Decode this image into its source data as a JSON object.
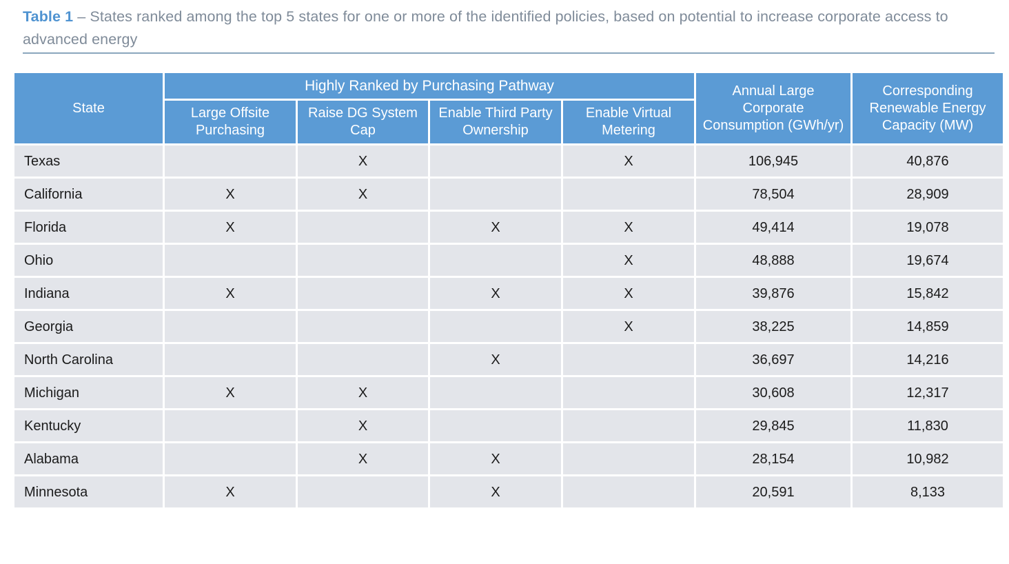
{
  "caption": {
    "label": "Table 1",
    "dash": " – ",
    "text": "States ranked among the top 5 states for one or more of the identified policies, based on potential to increase corporate access to advanced energy",
    "label_color": "#4f93d1",
    "text_color": "#7f8b99",
    "rule_color": "#8aa6bd"
  },
  "table": {
    "header_bg": "#5b9bd5",
    "header_fg": "#ffffff",
    "cell_bg": "#e3e5ea",
    "cell_fg": "#1b1b1b",
    "group_header": "Highly Ranked by Purchasing Pathway",
    "columns": [
      "State",
      "Large Offsite Purchasing",
      "Raise DG System Cap",
      "Enable Third Party Ownership",
      "Enable Virtual Metering",
      "Annual Large Corporate Consumption (GWh/yr)",
      "Corresponding Renewable Energy Capacity (MW)"
    ],
    "mark": "X",
    "rows": [
      {
        "state": "Texas",
        "large_offsite": "",
        "raise_dg": "X",
        "third_party": "",
        "virtual_metering": "X",
        "consumption": "106,945",
        "capacity": "40,876"
      },
      {
        "state": "California",
        "large_offsite": "X",
        "raise_dg": "X",
        "third_party": "",
        "virtual_metering": "",
        "consumption": "78,504",
        "capacity": "28,909"
      },
      {
        "state": "Florida",
        "large_offsite": "X",
        "raise_dg": "",
        "third_party": "X",
        "virtual_metering": "X",
        "consumption": "49,414",
        "capacity": "19,078"
      },
      {
        "state": "Ohio",
        "large_offsite": "",
        "raise_dg": "",
        "third_party": "",
        "virtual_metering": "X",
        "consumption": "48,888",
        "capacity": "19,674"
      },
      {
        "state": "Indiana",
        "large_offsite": "X",
        "raise_dg": "",
        "third_party": "X",
        "virtual_metering": "X",
        "consumption": "39,876",
        "capacity": "15,842"
      },
      {
        "state": "Georgia",
        "large_offsite": "",
        "raise_dg": "",
        "third_party": "",
        "virtual_metering": "X",
        "consumption": "38,225",
        "capacity": "14,859"
      },
      {
        "state": "North Carolina",
        "large_offsite": "",
        "raise_dg": "",
        "third_party": "X",
        "virtual_metering": "",
        "consumption": "36,697",
        "capacity": "14,216"
      },
      {
        "state": "Michigan",
        "large_offsite": "X",
        "raise_dg": "X",
        "third_party": "",
        "virtual_metering": "",
        "consumption": "30,608",
        "capacity": "12,317"
      },
      {
        "state": "Kentucky",
        "large_offsite": "",
        "raise_dg": "X",
        "third_party": "",
        "virtual_metering": "",
        "consumption": "29,845",
        "capacity": "11,830"
      },
      {
        "state": "Alabama",
        "large_offsite": "",
        "raise_dg": "X",
        "third_party": "X",
        "virtual_metering": "",
        "consumption": "28,154",
        "capacity": "10,982"
      },
      {
        "state": "Minnesota",
        "large_offsite": "X",
        "raise_dg": "",
        "third_party": "X",
        "virtual_metering": "",
        "consumption": "20,591",
        "capacity": "8,133"
      }
    ]
  }
}
